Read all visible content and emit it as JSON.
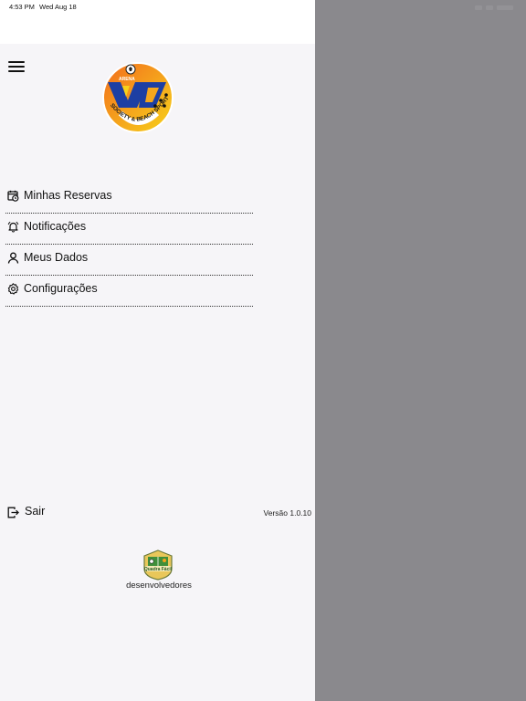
{
  "status_bar": {
    "time": "4:53 PM",
    "date": "Wed Aug 18"
  },
  "header": {
    "menu_icon": "hamburger-icon",
    "logo_icon": "arena-society-beach-sports-logo"
  },
  "menu": {
    "items": [
      {
        "label": "Minhas Reservas",
        "icon": "calendar-clock-icon"
      },
      {
        "label": "Notificações",
        "icon": "bell-icon"
      },
      {
        "label": "Meus Dados",
        "icon": "user-icon"
      },
      {
        "label": "Configurações",
        "icon": "gear-icon"
      }
    ]
  },
  "footer": {
    "logout_label": "Sair",
    "logout_icon": "logout-icon",
    "version": "Versão 1.0.10",
    "developer_logo": "quadra-facil-logo",
    "developer_label": "desenvolvedores"
  },
  "colors": {
    "drawer_bg": "#f6f5f8",
    "overlay_bg": "#8a898d",
    "logo_orange": "#f08a1c",
    "logo_yellow": "#f7d21a",
    "logo_blue": "#1d3fa3"
  },
  "logo_text": {
    "arena": "ARENA",
    "society": "SOCIETY & BEACH SPORTS",
    "dev": "Quadra Fácil"
  }
}
